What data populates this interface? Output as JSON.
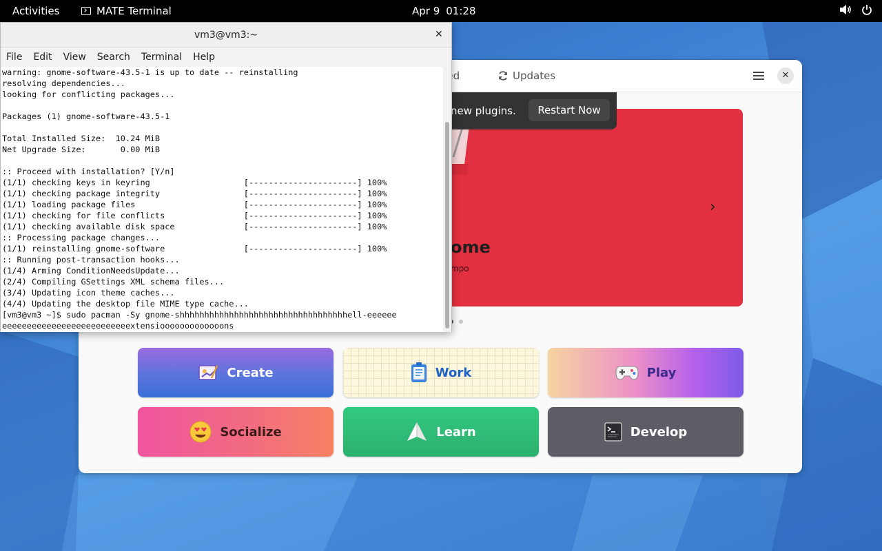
{
  "topbar": {
    "activities": "Activities",
    "app_name": "MATE Terminal",
    "date": "Apr 9",
    "time": "01:28",
    "icons": [
      "volume-icon",
      "power-icon"
    ]
  },
  "software": {
    "tabs": {
      "installed": "lled",
      "updates": "Updates"
    },
    "notification": {
      "text": "new plugins.",
      "button": "Restart Now"
    },
    "banner": {
      "title": "ome",
      "subtitle": "mpo"
    },
    "tiles": {
      "create": "Create",
      "work": "Work",
      "play": "Play",
      "socialize": "Socialize",
      "learn": "Learn",
      "develop": "Develop"
    }
  },
  "terminal": {
    "title": "vm3@vm3:~",
    "menu": [
      "File",
      "Edit",
      "View",
      "Search",
      "Terminal",
      "Help"
    ],
    "lines": [
      "warning: gnome-software-43.5-1 is up to date -- reinstalling",
      "resolving dependencies...",
      "looking for conflicting packages...",
      "",
      "Packages (1) gnome-software-43.5-1",
      "",
      "Total Installed Size:  10.24 MiB",
      "Net Upgrade Size:       0.00 MiB",
      "",
      ":: Proceed with installation? [Y/n]",
      "(1/1) checking keys in keyring                   [----------------------] 100%",
      "(1/1) checking package integrity                 [----------------------] 100%",
      "(1/1) loading package files                      [----------------------] 100%",
      "(1/1) checking for file conflicts                [----------------------] 100%",
      "(1/1) checking available disk space              [----------------------] 100%",
      ":: Processing package changes...",
      "(1/1) reinstalling gnome-software                [----------------------] 100%",
      ":: Running post-transaction hooks...",
      "(1/4) Arming ConditionNeedsUpdate...",
      "(2/4) Compiling GSettings XML schema files...",
      "(3/4) Updating icon theme caches...",
      "(4/4) Updating the desktop file MIME type cache...",
      "[vm3@vm3 ~]$ sudo pacman -Sy gnome-shhhhhhhhhhhhhhhhhhhhhhhhhhhhhhhhhhell-eeeeee",
      "eeeeeeeeeeeeeeeeeeeeeeeeeextensiooooooooooooons"
    ]
  }
}
